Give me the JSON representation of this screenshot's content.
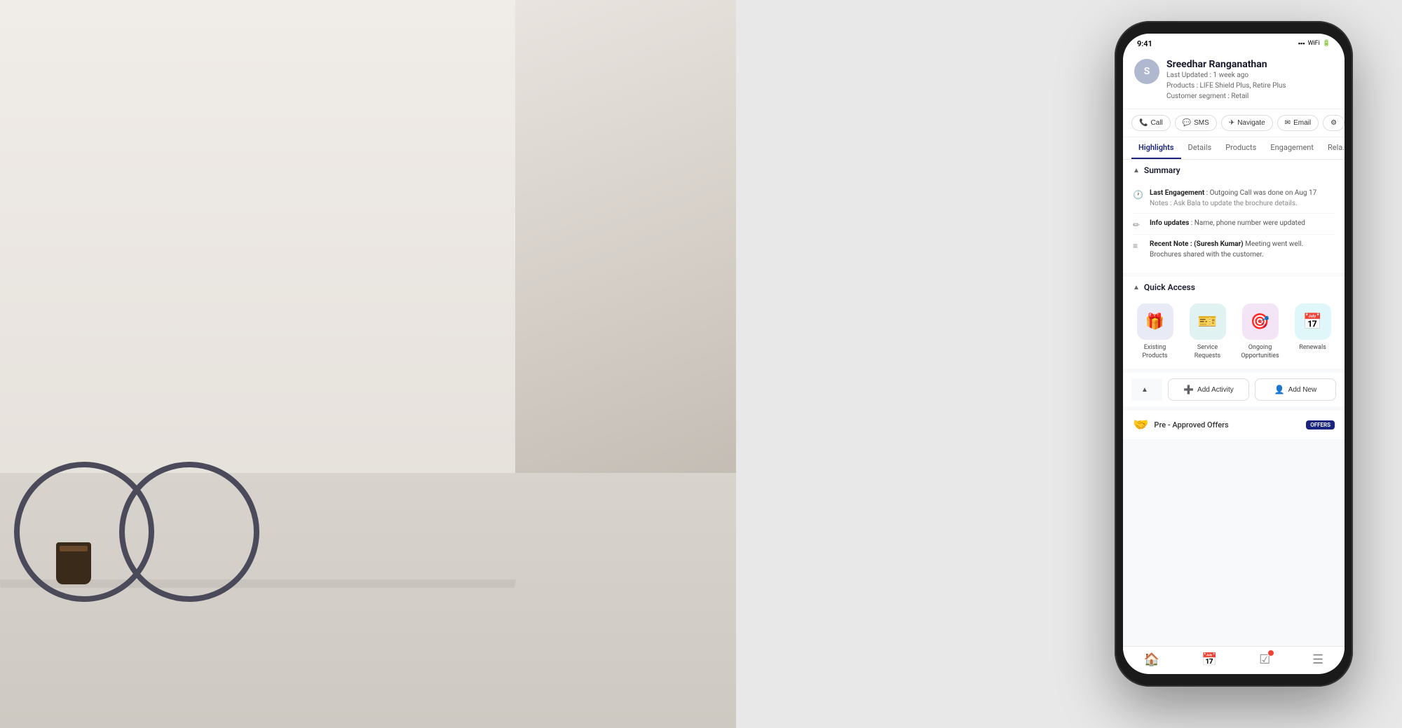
{
  "background": {
    "leftBg": "photo-background"
  },
  "phone": {
    "statusBar": {
      "time": "9:41",
      "battery": "●●●",
      "signal": "◆◆◆"
    },
    "contact": {
      "avatarLetter": "S",
      "name": "Sreedhar Ranganathan",
      "lastUpdated": "Last Updated : 1 week ago",
      "products": "Products : LIFE Shield Plus, Retire Plus",
      "customerSegment": "Customer segment : Retail",
      "productsLabel": "Products",
      "lastUpdatedLabel": "Last Updated",
      "customerSegmentLabel": "Customer segment"
    },
    "actionButtons": [
      {
        "id": "call",
        "icon": "📞",
        "label": "Call"
      },
      {
        "id": "sms",
        "icon": "💬",
        "label": "SMS"
      },
      {
        "id": "navigate",
        "icon": "✈",
        "label": "Navigate"
      },
      {
        "id": "email",
        "icon": "✉",
        "label": "Email"
      },
      {
        "id": "more",
        "icon": "⚙",
        "label": ""
      }
    ],
    "tabs": [
      {
        "id": "highlights",
        "label": "Highlights",
        "active": true
      },
      {
        "id": "details",
        "label": "Details",
        "active": false
      },
      {
        "id": "products",
        "label": "Products",
        "active": false
      },
      {
        "id": "engagement",
        "label": "Engagement",
        "active": false
      },
      {
        "id": "related",
        "label": "Rela...",
        "active": false
      }
    ],
    "summary": {
      "title": "Summary",
      "items": [
        {
          "id": "last-engagement",
          "icon": "🕐",
          "label": "Last Engagement",
          "text": " : Outgoing Call was done on Aug 17",
          "note": "Notes :  Ask Bala to update the brochure details."
        },
        {
          "id": "info-updates",
          "icon": "✏",
          "label": "Info updates",
          "text": " : Name, phone number were updated"
        },
        {
          "id": "recent-note",
          "icon": "≡",
          "label": "Recent Note : (Suresh Kumar)",
          "text": " Meeting went well. Brochures shared with the customer."
        }
      ]
    },
    "quickAccess": {
      "title": "Quick Access",
      "items": [
        {
          "id": "existing-products",
          "icon": "🎁",
          "label": "Existing\nProducts",
          "colorClass": "qa-blue"
        },
        {
          "id": "service-requests",
          "icon": "🎫",
          "label": "Service\nRequests",
          "colorClass": "qa-teal"
        },
        {
          "id": "ongoing-opportunities",
          "icon": "🎯",
          "label": "Ongoing\nOpportunities",
          "colorClass": "qa-purple"
        },
        {
          "id": "renewals",
          "icon": "📅",
          "label": "Renewals",
          "colorClass": "qa-cyan"
        }
      ]
    },
    "quickActions": {
      "addActivity": "Add Activity",
      "addNew": "Add New",
      "addActivityIcon": "➕",
      "addNewIcon": "👤"
    },
    "offers": {
      "icon": "🤝",
      "label": "Pre - Approved Offers",
      "badge": "OFFERS"
    },
    "bottomNav": [
      {
        "id": "home",
        "icon": "🏠",
        "active": true
      },
      {
        "id": "calendar",
        "icon": "📅",
        "active": false
      },
      {
        "id": "tasks",
        "icon": "☑",
        "active": false,
        "hasBadge": true
      },
      {
        "id": "menu",
        "icon": "☰",
        "active": false
      }
    ]
  }
}
